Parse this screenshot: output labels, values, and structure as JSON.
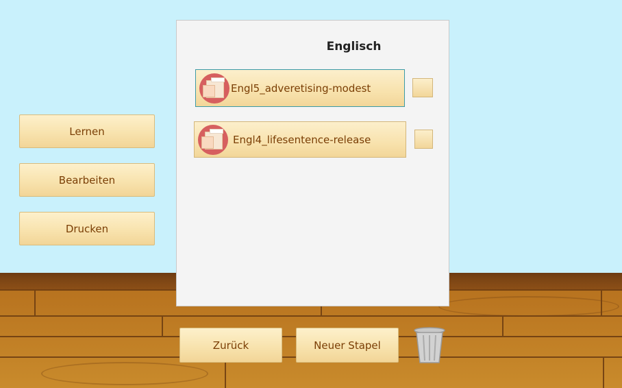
{
  "sidebar": {
    "learn_label": "Lernen",
    "edit_label": "Bearbeiten",
    "print_label": "Drucken"
  },
  "panel": {
    "title": "Englisch",
    "decks": [
      {
        "label": "Engl5_adveretising-modest",
        "selected": true
      },
      {
        "label": "Engl4_lifesentence-release",
        "selected": false
      }
    ]
  },
  "footer": {
    "back_label": "Zurück",
    "new_deck_label": "Neuer Stapel",
    "trash_icon": "trash-can-icon"
  },
  "colors": {
    "wall": "#c9f1fc",
    "button_text": "#7a3e05",
    "icon_bg": "#d65f5f",
    "selection_border": "#3a9aa6"
  }
}
